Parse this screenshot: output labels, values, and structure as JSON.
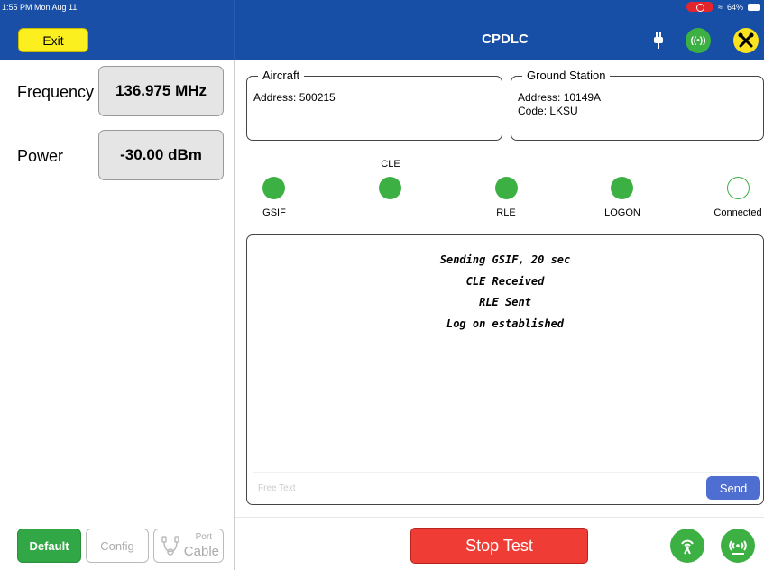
{
  "status_bar": {
    "time": "1:55 PM  Mon Aug 11",
    "battery": "64%"
  },
  "header": {
    "exit_label": "Exit",
    "title": "CPDLC"
  },
  "left": {
    "frequency_label": "Frequency",
    "frequency_value": "136.975 MHz",
    "power_label": "Power",
    "power_value": "-30.00 dBm"
  },
  "aircraft": {
    "legend": "Aircraft",
    "address": "Address: 500215"
  },
  "ground_station": {
    "legend": "Ground Station",
    "address": "Address: 10149A",
    "code": "Code: LKSU"
  },
  "steps": {
    "top_label": "CLE",
    "labels": [
      "GSIF",
      "RLE",
      "LOGON",
      "Connected"
    ]
  },
  "log": {
    "lines": [
      "Sending GSIF, 20 sec",
      "CLE Received",
      "RLE Sent",
      "Log on established"
    ],
    "free_text_placeholder": "Free Text",
    "send_label": "Send"
  },
  "bottom": {
    "default_label": "Default",
    "config_label": "Config",
    "port_label": "Port",
    "cable_label": "Cable",
    "stop_label": "Stop Test"
  },
  "colors": {
    "header_blue": "#174ea6",
    "accent_green": "#3cb043",
    "stop_red": "#ef3d35",
    "exit_yellow": "#fbef1f"
  }
}
